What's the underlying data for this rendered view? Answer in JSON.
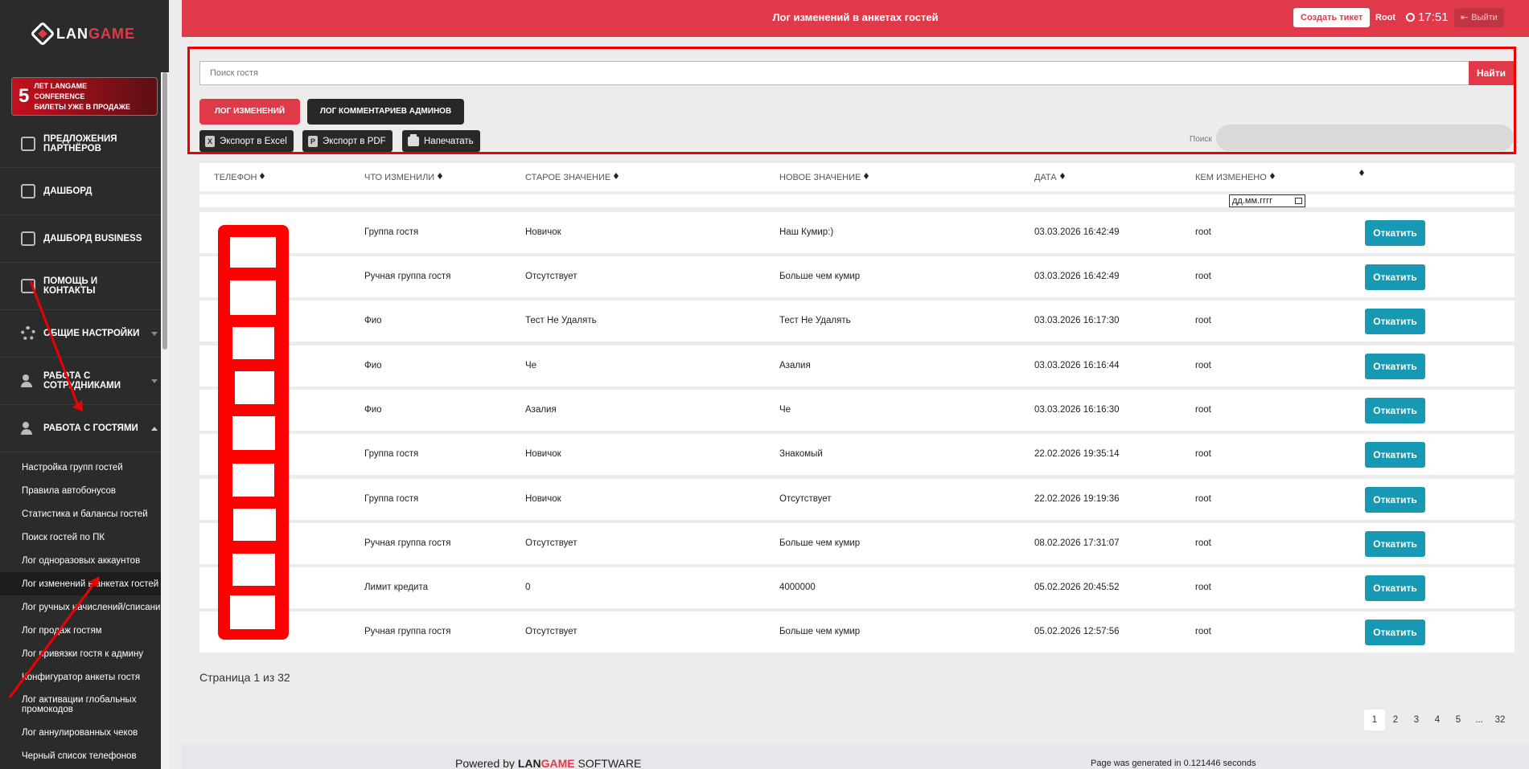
{
  "sidebar": {
    "logo": {
      "part1": "LAN",
      "part2": "GAME"
    },
    "promo": {
      "number": "5",
      "line1": "ЛЕТ LANGAME",
      "line2": "CONFERENCE",
      "line3": "БИЛЕТЫ УЖЕ В ПРОДАЖЕ"
    },
    "nav": [
      {
        "label": "ПРЕДЛОЖЕНИЯ ПАРТНЁРОВ",
        "icon": "edit-icon"
      },
      {
        "label": "ДАШБОРД",
        "icon": "book-icon"
      },
      {
        "label": "ДАШБОРД BUSINESS",
        "icon": "edit-icon"
      },
      {
        "label": "ПОМОЩЬ И КОНТАКТЫ",
        "icon": "edit-icon"
      },
      {
        "label": "ОБЩИЕ НАСТРОЙКИ",
        "icon": "gear-icon"
      },
      {
        "label": "РАБОТА С СОТРУДНИКАМИ",
        "icon": "users-icon"
      },
      {
        "label": "РАБОТА С ГОСТЯМИ",
        "icon": "users-icon"
      }
    ],
    "sub_items": [
      "Настройка групп гостей",
      "Правила автобонусов",
      "Статистика и балансы гостей",
      "Поиск гостей по ПК",
      "Лог одноразовых аккаунтов",
      "Лог изменений в анкетах гостей",
      "Лог ручных начислений/списаний",
      "Лог продаж гостям",
      "Лог привязки гостя к админу",
      "Конфигуратор анкеты гостя",
      "Лог активации глобальных промокодов",
      "Лог аннулированных чеков",
      "Черный список телефонов"
    ]
  },
  "header": {
    "title": "Лог изменений в анкетах гостей",
    "ticket": "Создать тикет",
    "user": "Root",
    "time": "17:51",
    "logout": "Выйти"
  },
  "controls": {
    "search_placeholder": "Поиск гостя",
    "search_button": "Найти",
    "tab_log": "ЛОГ ИЗМЕНЕНИЙ",
    "tab_admin": "ЛОГ КОММЕНТАРИЕВ АДМИНОВ",
    "export_excel": "Экспорт в Excel",
    "export_pdf": "Экспорт в PDF",
    "print": "Напечатать",
    "table_search_label": "Поиск"
  },
  "table": {
    "headers": [
      "ТЕЛЕФОН",
      "ЧТО ИЗМЕНИЛИ",
      "СТАРОЕ ЗНАЧЕНИЕ",
      "НОВОЕ ЗНАЧЕНИЕ",
      "ДАТА",
      "КЕМ ИЗМЕНЕНО"
    ],
    "date_filter": "дд.мм.гггг",
    "rollback_label": "Откатить",
    "rows": [
      {
        "field": "Группа гостя",
        "old": "Новичок",
        "new": "Наш Кумир:)",
        "date": "03.03.2026 16:42:49",
        "by": "root"
      },
      {
        "field": "Ручная группа гостя",
        "old": "Отсутствует",
        "new": "Больше чем кумир",
        "date": "03.03.2026 16:42:49",
        "by": "root"
      },
      {
        "field": "Фио",
        "old": "Тест Не Удалять",
        "new": "Тест Не Удалять",
        "date": "03.03.2026 16:17:30",
        "by": "root"
      },
      {
        "field": "Фио",
        "old": "Че",
        "new": "Азалия",
        "date": "03.03.2026 16:16:44",
        "by": "root"
      },
      {
        "field": "Фио",
        "old": "Азалия",
        "new": "Че",
        "date": "03.03.2026 16:16:30",
        "by": "root"
      },
      {
        "field": "Группа гостя",
        "old": "Новичок",
        "new": "Знакомый",
        "date": "22.02.2026 19:35:14",
        "by": "root"
      },
      {
        "field": "Группа гостя",
        "old": "Новичок",
        "new": "Отсутствует",
        "date": "22.02.2026 19:19:36",
        "by": "root"
      },
      {
        "field": "Ручная группа гостя",
        "old": "Отсутствует",
        "new": "Больше чем кумир",
        "date": "08.02.2026 17:31:07",
        "by": "root"
      },
      {
        "field": "Лимит кредита",
        "old": "0",
        "new": "4000000",
        "date": "05.02.2026 20:45:52",
        "by": "root"
      },
      {
        "field": "Ручная группа гостя",
        "old": "Отсутствует",
        "new": "Больше чем кумир",
        "date": "05.02.2026 12:57:56",
        "by": "root"
      }
    ]
  },
  "pagination": {
    "status": "Страница 1 из 32",
    "pages": [
      "1",
      "2",
      "3",
      "4",
      "5",
      "...",
      "32"
    ]
  },
  "footer": {
    "powered_prefix": "Powered by ",
    "brand1": "LAN",
    "brand2": "GAME",
    "powered_suffix": " SOFTWARE",
    "generated": "Page was generated in 0.121446 seconds"
  },
  "colors": {
    "accent": "#e03a4a",
    "sidebar": "#2b2b2b",
    "rollback": "#1799b3"
  }
}
